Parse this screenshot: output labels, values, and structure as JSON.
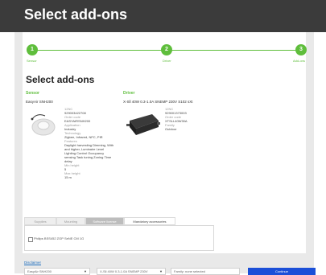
{
  "header": {
    "title": "Select add-ons"
  },
  "stepper": [
    {
      "number": "1",
      "label": "Sensor"
    },
    {
      "number": "2",
      "label": "Driver"
    },
    {
      "number": "3",
      "label": "Add-ons"
    }
  ],
  "main": {
    "title": "Select add-ons",
    "sensor": {
      "section_label": "Sensor",
      "name": "EasyAir SNH200",
      "specs": [
        {
          "k": "12NC",
          "v": "929003422708"
        },
        {
          "k": "Order code",
          "v": "EASYAIRSNH200"
        },
        {
          "k": "Application",
          "v": "Industry"
        },
        {
          "k": "Technology",
          "v": "Zigbee, Infrared, NFC, PIR"
        },
        {
          "k": "Features",
          "v": "Daylight harvesting Dimming, With and higher, Luminaire Level Lighting Control Occupancy sensing Task tuning Zoning Time delay"
        },
        {
          "k": "Min height",
          "v": "5"
        },
        {
          "k": "Max height",
          "v": "15 m"
        }
      ]
    },
    "driver": {
      "section_label": "Driver",
      "name": "X-Sll 40W 0.3-1.0A SNEMP 230V S102 sXt",
      "specs": [
        {
          "k": "12NC",
          "v": "929001373003"
        },
        {
          "k": "Order code",
          "v": "XTSLL40W30A"
        },
        {
          "k": "Family",
          "v": "Outdoor"
        }
      ]
    }
  },
  "tabs": [
    {
      "label": "Supplies"
    },
    {
      "label": "Mounting"
    },
    {
      "label": "Software license"
    },
    {
      "label": "Mandatory accessories"
    }
  ],
  "checkbox": {
    "label": "Philips BSS452 ZGP SeNE CM 1G"
  },
  "footer": {
    "link": "Disclaimer",
    "select1": "EasyAir SNH200",
    "select2": "X-Sll 40W 0.3-1.0A SNEMP 230V",
    "select3": "Family: none selected",
    "continue_label": "Continue"
  },
  "colors": {
    "accent": "#5fbe3c",
    "primary_button": "#1b4fd8",
    "header": "#3b3b3b"
  }
}
